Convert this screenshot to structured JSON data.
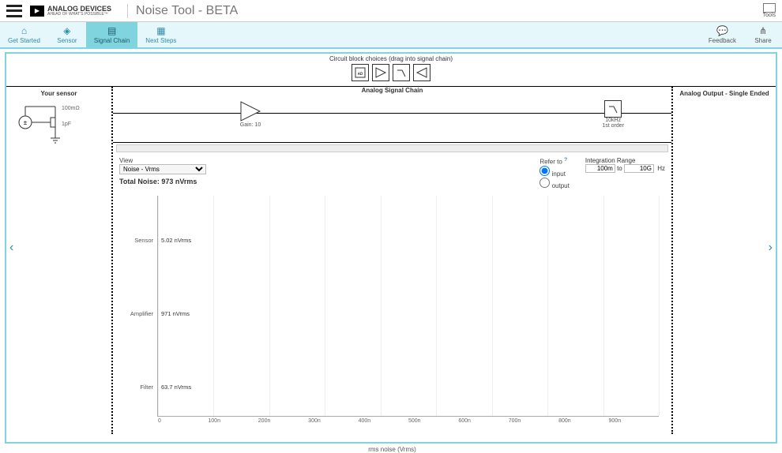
{
  "brand": {
    "name_line1": "ANALOG",
    "name_line2": "DEVICES",
    "tagline": "AHEAD OF WHAT'S POSSIBLE™"
  },
  "app_title": "Noise Tool - BETA",
  "top_right": {
    "tools_label": "Tools"
  },
  "nav": {
    "items": [
      {
        "icon": "⌂",
        "label": "Get Started"
      },
      {
        "icon": "◈",
        "label": "Sensor"
      },
      {
        "icon": "▤",
        "label": "Signal Chain"
      },
      {
        "icon": "▦",
        "label": "Next Steps"
      }
    ],
    "active_index": 2,
    "feedback_label": "Feedback",
    "share_label": "Share"
  },
  "palette": {
    "title": "Circuit block choices (drag into signal chain)",
    "blocks": [
      "adc",
      "amplifier",
      "filter",
      "output"
    ]
  },
  "sections": {
    "left_title": "Your sensor",
    "mid_title": "Analog Signal Chain",
    "right_title": "Analog Output - Single Ended"
  },
  "sensor": {
    "res_label": "100mΩ",
    "cap_label": "1pF"
  },
  "chain": {
    "amp": {
      "label_line1": "Gain: 10"
    },
    "filter": {
      "label_line1": "10kHz",
      "label_line2": "1st order"
    }
  },
  "controls": {
    "view_label": "View",
    "view_value": "Noise - Vrms",
    "refer_label": "Refer to",
    "refer_options": {
      "input": "input",
      "output": "output"
    },
    "refer_selected": "input",
    "int_label": "Integration Range",
    "int_from": "100m",
    "int_to_word": "to",
    "int_to": "10G",
    "int_unit": "Hz",
    "total_noise": "Total Noise: 973 nVrms"
  },
  "chart_data": {
    "type": "bar",
    "orientation": "horizontal",
    "title": "",
    "xlabel": "rms noise (Vrms)",
    "ylabel": "",
    "xlim_label_ticks": [
      "0",
      "100n",
      "200n",
      "300n",
      "400n",
      "500n",
      "600n",
      "700n",
      "800n",
      "900n"
    ],
    "x_max_value": 1000,
    "categories": [
      "Sensor",
      "Amplifier",
      "Filter"
    ],
    "series": [
      {
        "name": "noise",
        "values": [
          5.02,
          971,
          63.7
        ],
        "value_unit": "nVrms",
        "value_labels": [
          "5.02 nVrms",
          "971 nVrms",
          "63.7 nVrms"
        ],
        "colors": [
          "#29bcd8",
          "#1795b2",
          "#29bcd8"
        ]
      }
    ]
  }
}
